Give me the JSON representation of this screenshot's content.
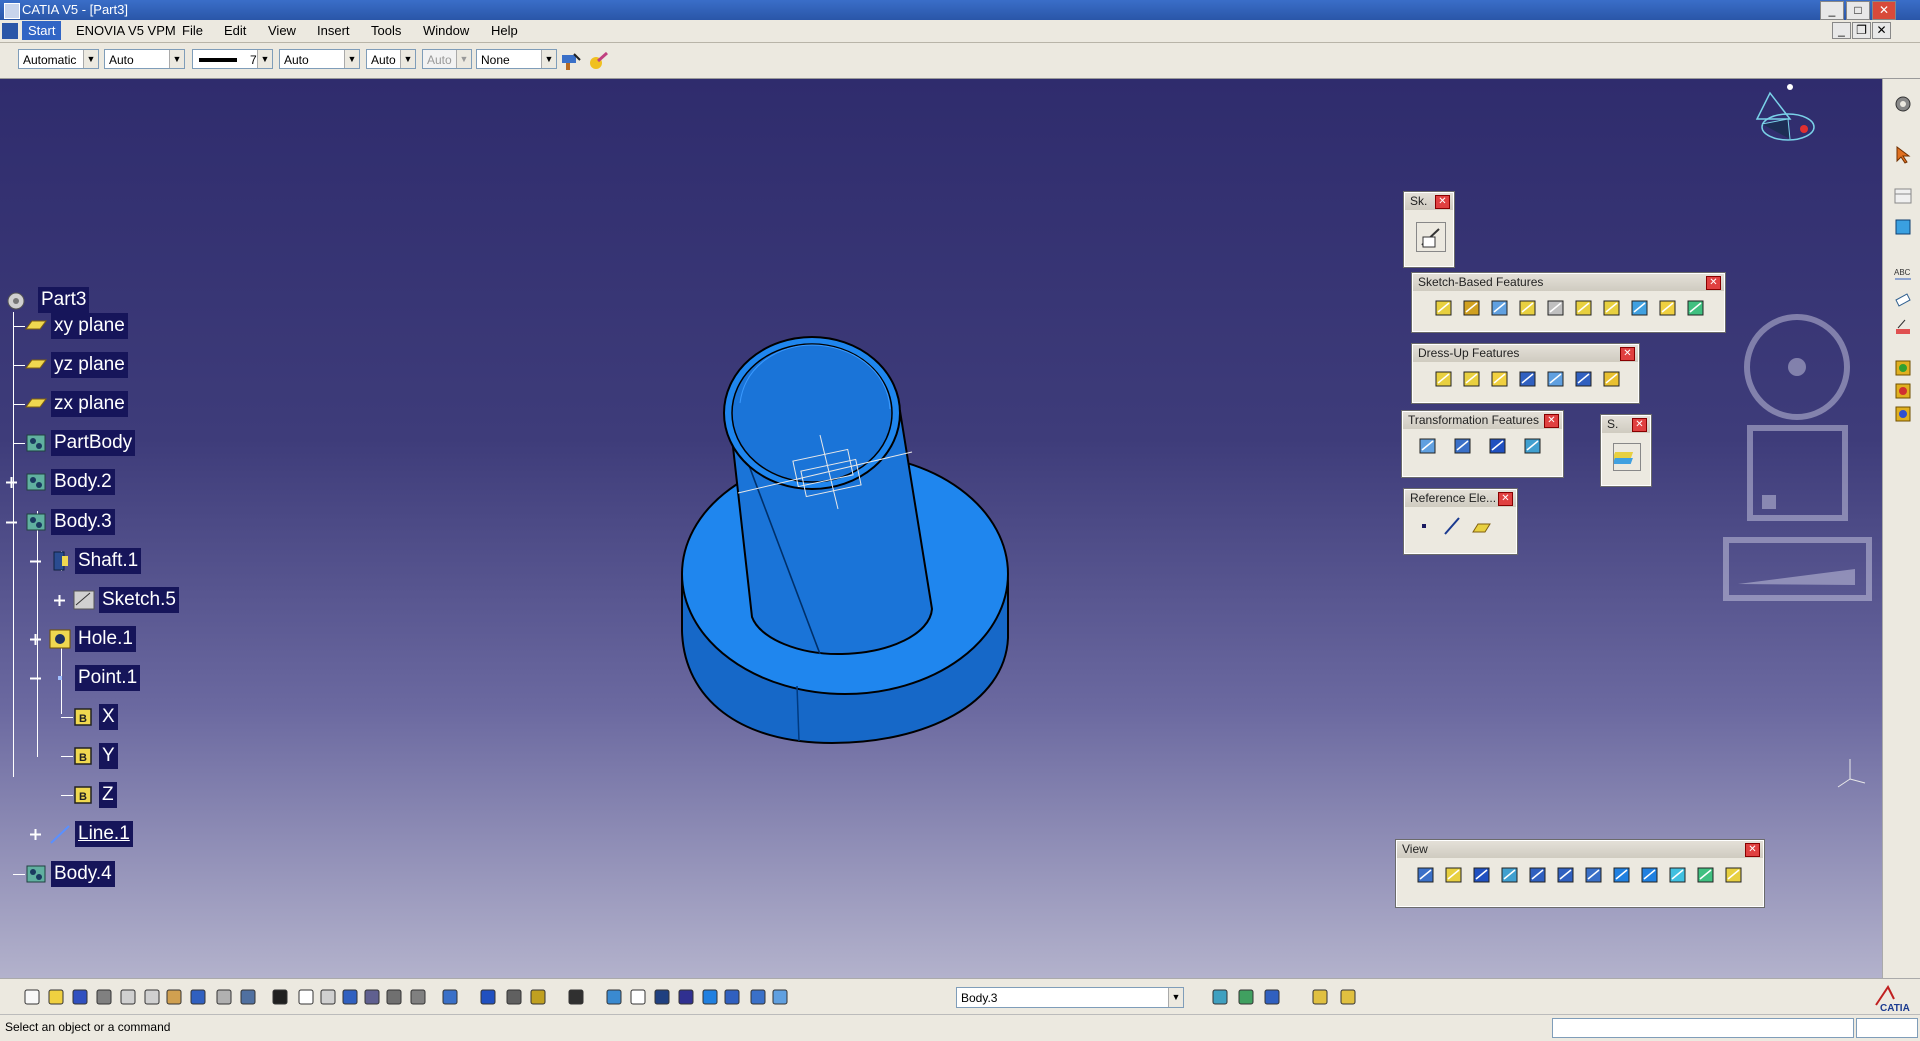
{
  "window": {
    "title": "CATIA V5 - [Part3]",
    "controls": [
      "_",
      "□",
      "✕"
    ],
    "doc_controls": [
      "_",
      "❐",
      "✕"
    ]
  },
  "menubar": {
    "items": [
      "Start",
      "ENOVIA V5 VPM",
      "File",
      "Edit",
      "View",
      "Insert",
      "Tools",
      "Window",
      "Help"
    ]
  },
  "graphic_properties": {
    "fill_color": "Automatic",
    "transparency": "Auto",
    "line_weight": "7",
    "line_type": "Auto",
    "point_symbol": "Auto",
    "rendering": "Auto",
    "layer": "None"
  },
  "tree": {
    "root": "Part3",
    "nodes": [
      {
        "label": "xy plane",
        "icon": "plane-icon"
      },
      {
        "label": "yz plane",
        "icon": "plane-icon"
      },
      {
        "label": "zx plane",
        "icon": "plane-icon"
      },
      {
        "label": "PartBody",
        "icon": "body-icon"
      },
      {
        "label": "Body.2",
        "icon": "body-icon"
      },
      {
        "label": "Body.3",
        "icon": "body-icon"
      },
      {
        "label": "Shaft.1",
        "icon": "shaft-icon"
      },
      {
        "label": "Sketch.5",
        "icon": "sketch-icon"
      },
      {
        "label": "Hole.1",
        "icon": "hole-icon"
      },
      {
        "label": "Point.1",
        "icon": "point-icon"
      },
      {
        "label": "X",
        "icon": "parameter-icon"
      },
      {
        "label": "Y",
        "icon": "parameter-icon"
      },
      {
        "label": "Z",
        "icon": "parameter-icon"
      },
      {
        "label": "Line.1",
        "icon": "line-icon"
      },
      {
        "label": "Body.4",
        "icon": "body-icon"
      }
    ]
  },
  "palettes": {
    "sketcher": "Sk.",
    "sketch_based": "Sketch-Based Features",
    "dress_up": "Dress-Up Features",
    "transformation": "Transformation Features",
    "surface_based": "S.",
    "reference": "Reference Ele...",
    "view": "View"
  },
  "bottom_toolbar": {
    "current_body": "Body.3"
  },
  "status": {
    "message": "Select an object or a command"
  },
  "colors": {
    "part_blue": "#1a7ae6",
    "viewport_top": "#2f2c6d",
    "viewport_bottom": "#b3b2cc",
    "tree_label_bg": "#16155a"
  }
}
